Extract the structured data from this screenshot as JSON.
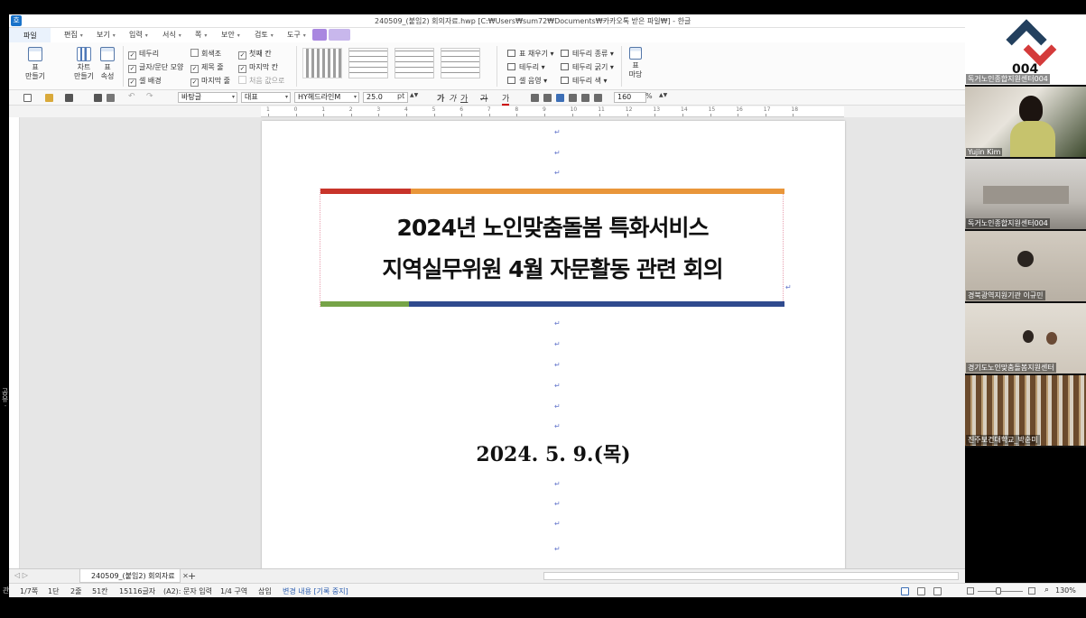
{
  "window": {
    "title": "240509_(붙임2) 회의자료.hwp [C:₩Users₩sum72₩Documents₩카카오톡 받은 파일₩] - 한글"
  },
  "menu": {
    "file": "파일",
    "items": [
      "편집",
      "보기",
      "입력",
      "서식",
      "쪽",
      "보안",
      "검토",
      "도구"
    ]
  },
  "ribbon": {
    "table_make": "표\n만들기",
    "chart_make": "차트\n만들기",
    "table_props": "표\n속성",
    "checks_col1": [
      {
        "label": "테두리",
        "checked": true
      },
      {
        "label": "글자/문단 모양",
        "checked": true
      },
      {
        "label": "셀 배경",
        "checked": true
      }
    ],
    "checks_col2": [
      {
        "label": "회색조",
        "checked": false
      },
      {
        "label": "제목 줄",
        "checked": true
      },
      {
        "label": "마지막 줄",
        "checked": true
      }
    ],
    "checks_col3": [
      {
        "label": "첫째 칸",
        "checked": true
      },
      {
        "label": "마지막 칸",
        "checked": true
      },
      {
        "label": "처음 값으로",
        "checked": false
      }
    ],
    "fill_col": [
      "표 채우기",
      "테두리",
      "셀 음영"
    ],
    "border_col": [
      "테두리 종류",
      "테두리 굵기",
      "테두리 색"
    ],
    "table_margin": "표\n마당"
  },
  "toolbar": {
    "style": "바탕글",
    "script": "대표",
    "font": "HY헤드라인M",
    "size": "25.0",
    "size_unit": "pt",
    "text_styles": [
      "가",
      "가",
      "가",
      "가",
      "가"
    ],
    "zoom": "160",
    "zoom_unit": "%"
  },
  "ruler": {
    "labels": [
      "1",
      "0",
      "1",
      "2",
      "3",
      "4",
      "5",
      "6",
      "7",
      "8",
      "9",
      "10",
      "11",
      "12",
      "13",
      "14",
      "15",
      "16",
      "17",
      "18"
    ]
  },
  "document": {
    "para_mark": "↵",
    "title_line1": "2024년 노인맞춤돌봄 특화서비스",
    "title_line2": "지역실무위원 4월 자문활동 관련 회의",
    "date": "2024. 5. 9.(목)"
  },
  "tabs": {
    "doc_tab": "240509_(붙임2) 회의자료",
    "add": "+"
  },
  "status": {
    "page": "1/7쪽",
    "column": "1단",
    "line": "2줄",
    "col": "51칸",
    "chars": "15116글자",
    "input": "(A2): 문자 입력",
    "section": "1/4 구역",
    "mode": "삽입",
    "track": "변경 내용 [기록 중지]",
    "zoom": "130%"
  },
  "video_tiles": [
    {
      "name": "독거노인종합지원센터004",
      "logo_text": "004"
    },
    {
      "name": "Yujin Kim"
    },
    {
      "name": "독거노인종합지원센터004"
    },
    {
      "name": "경북광역지원기관 이규민"
    },
    {
      "name": "경기도노인맞춤돌봄지원센터"
    },
    {
      "name": "진주보건대학교_박순미"
    }
  ],
  "side_label": "공유 ·",
  "side_label2": "관"
}
